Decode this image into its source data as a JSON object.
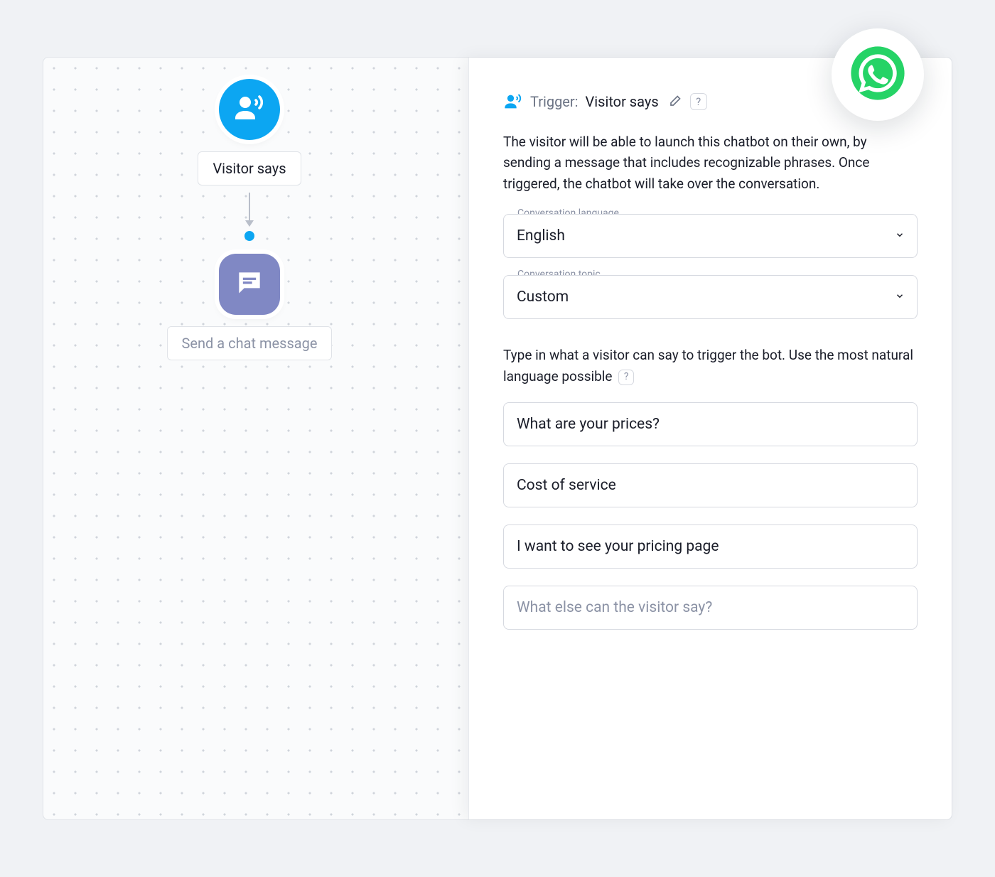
{
  "flow": {
    "node1_label": "Visitor says",
    "node2_label": "Send a chat message"
  },
  "panel": {
    "trigger_prefix": "Trigger:",
    "trigger_name": "Visitor says",
    "description": "The visitor will be able to launch this chatbot on their own, by sending a message that includes recognizable phrases. Once triggered, the chatbot will take over the conversation.",
    "language_label": "Conversation language",
    "language_value": "English",
    "topic_label": "Conversation topic",
    "topic_value": "Custom",
    "instruction": "Type in what a visitor can say to trigger the bot. Use the most natural language possible",
    "phrases": [
      "What are your prices?",
      "Cost of service",
      "I want to see your pricing page"
    ],
    "new_phrase_placeholder": "What else can the visitor say?",
    "help_char": "?"
  }
}
